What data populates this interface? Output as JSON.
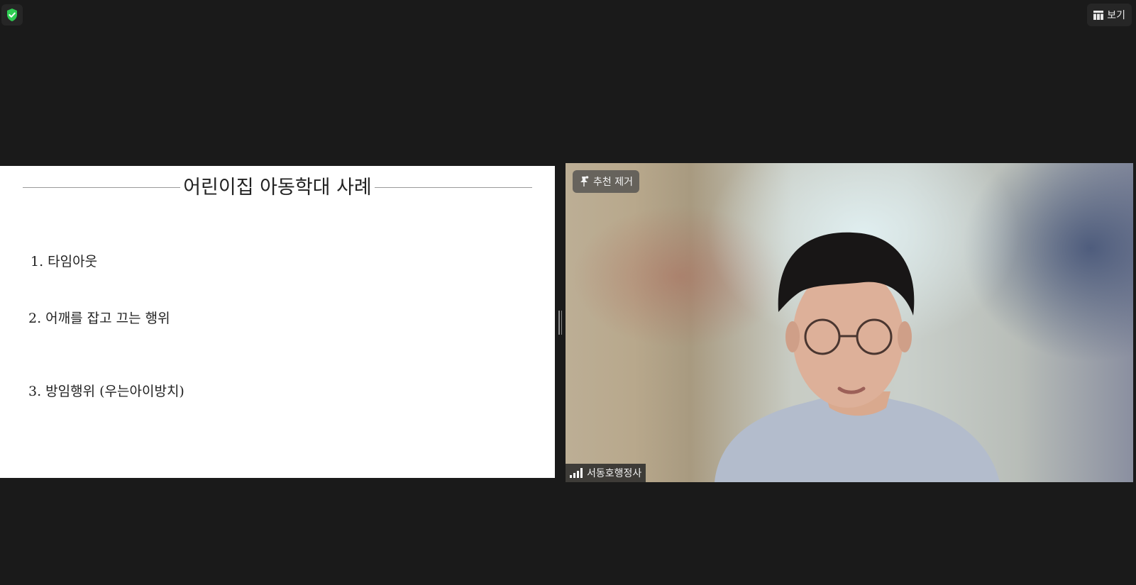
{
  "top_bar": {
    "view_label": "보기"
  },
  "shared_slide": {
    "title": "어린이집 아동학대 사례",
    "items": [
      "1.  타임아웃",
      "2. 어깨를 잡고 끄는 행위",
      "3. 방임행위 (우는아이방치)"
    ]
  },
  "video": {
    "pin_label": "추천 제거",
    "participant_name": "서동호행정사"
  },
  "colors": {
    "background": "#1a1a1a",
    "shield_green": "#2ecc52"
  },
  "icons": [
    "shield-check-icon",
    "grid-view-icon",
    "pin-icon",
    "signal-strength-icon"
  ]
}
